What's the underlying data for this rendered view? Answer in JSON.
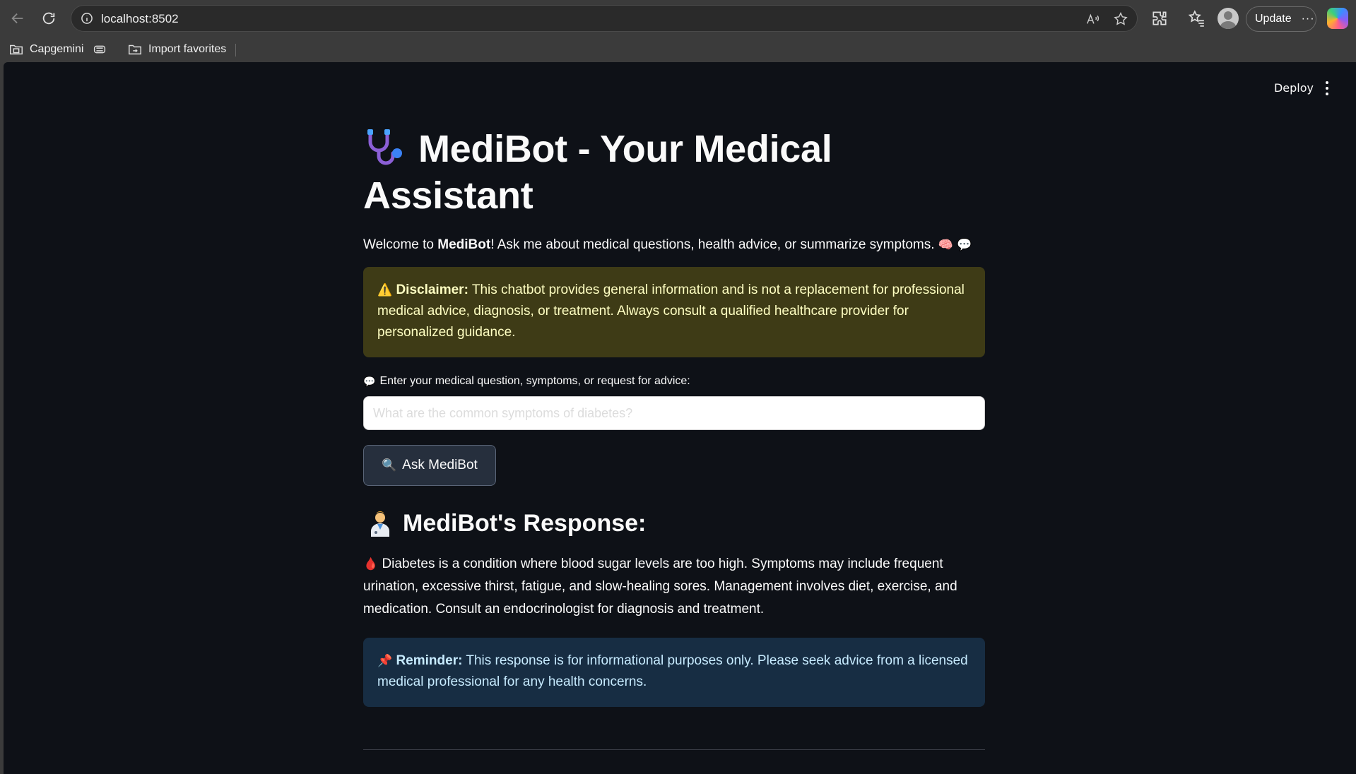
{
  "browser": {
    "url": "localhost:8502",
    "update_label": "Update",
    "bookmarks": [
      "Capgemini",
      "Import favorites"
    ]
  },
  "app_header": {
    "deploy_label": "Deploy"
  },
  "page": {
    "title": "MediBot - Your Medical Assistant",
    "welcome_prefix": "Welcome to ",
    "welcome_bold": "MediBot",
    "welcome_suffix": "! Ask me about medical questions, health advice, or summarize symptoms.",
    "disclaimer_label": "Disclaimer:",
    "disclaimer_text": " This chatbot provides general information and is not a replacement for professional medical advice, diagnosis, or treatment. Always consult a qualified healthcare provider for personalized guidance.",
    "input_label": "Enter your medical question, symptoms, or request for advice:",
    "input_placeholder": "What are the common symptoms of diabetes?",
    "input_value": "",
    "ask_button_label": "Ask MediBot",
    "response_heading": "MediBot's Response:",
    "response_text": "Diabetes is a condition where blood sugar levels are too high. Symptoms may include frequent urination, excessive thirst, fatigue, and slow-healing sores. Management involves diet, exercise, and medication. Consult an endocrinologist for diagnosis and treatment.",
    "reminder_label": "Reminder:",
    "reminder_text": " This response is for informational purposes only. Please seek advice from a licensed medical professional for any health concerns."
  },
  "colors": {
    "app_background": "#0e1117",
    "warning_background": "#3e3b16",
    "warning_text": "#ffffc2",
    "info_background": "#172d43",
    "info_text": "#c7ebff",
    "button_background": "#262f3d"
  },
  "icons": [
    "back-arrow-icon",
    "refresh-icon",
    "info-icon",
    "read-aloud-icon",
    "star-icon",
    "extensions-icon",
    "favorites-icon",
    "profile-icon",
    "more-icon",
    "copilot-icon",
    "folder-icon",
    "collections-icon",
    "stethoscope-icon",
    "brain-icon",
    "speech-bubble-icon",
    "warning-icon",
    "magnifier-icon",
    "health-worker-icon",
    "drop-of-blood-icon",
    "pushpin-icon",
    "kebab-menu-icon"
  ]
}
